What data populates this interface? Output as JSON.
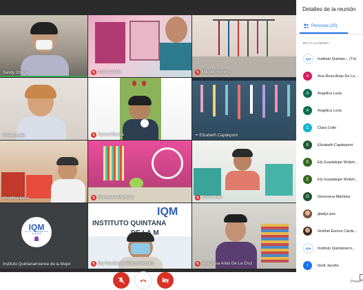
{
  "tiles": [
    {
      "name": "Sandy Ortega",
      "muted": false,
      "speaking": true
    },
    {
      "name": "Itzelt Jacobo",
      "muted": true
    },
    {
      "name": "Marbel Herrera",
      "muted": true
    },
    {
      "name": "Silvia Lopez",
      "muted": false
    },
    {
      "name": "Yaremi Rivera",
      "muted": true
    },
    {
      "name": "Elizabeth Capdepont",
      "muted": false,
      "dots": true
    },
    {
      "name": "Angelica Luna",
      "muted": false
    },
    {
      "name": "Genoveva Martinez",
      "muted": true
    },
    {
      "name": "Clara Colin",
      "muted": true
    },
    {
      "name": "Instituto Quintanarroense de la Mujer",
      "muted": false,
      "logo_text": "IQM",
      "logo_sub": "INSTITUTO QUINTANARROENSE DE LA MUJER"
    },
    {
      "name": "Ely Guadalupe Wuitzil Mendez",
      "muted": true,
      "sign_top": "IQM",
      "sign_line1": "INSTITUTO QUINTANA",
      "sign_line2": "DE LA M"
    },
    {
      "name": "Ana Rosa Arias De La Cruz",
      "muted": true
    }
  ],
  "panel": {
    "title": "Detalles de la reunión",
    "people_tab": "Personas (20)",
    "section": "EN LA LLAMADA",
    "present_label": "Presen"
  },
  "people": [
    {
      "name": "Instituto Quintan... (Tú)",
      "type": "logo",
      "color": "#1a73e8"
    },
    {
      "name": "Ana Rosa Arias De La ...",
      "initial": "A",
      "color": "#d81b60"
    },
    {
      "name": "Angelica Luna",
      "initial": "A",
      "color": "#0b6e4f"
    },
    {
      "name": "Angelica Luna",
      "initial": "A",
      "color": "#0b6e4f"
    },
    {
      "name": "Clara Colin",
      "initial": "C",
      "color": "#12b5cb"
    },
    {
      "name": "Elizabeth Capdepont",
      "initial": "E",
      "color": "#1e5631"
    },
    {
      "name": "Ely Guadalupe Wuitzil...",
      "initial": "E",
      "color": "#33691e"
    },
    {
      "name": "Ely Guadalupe Wuitzil...",
      "initial": "E",
      "color": "#33691e"
    },
    {
      "name": "Genoveva Martinez",
      "initial": "G",
      "color": "#1e5631"
    },
    {
      "name": "gladys puc",
      "type": "photo",
      "color": "#c58a6b"
    },
    {
      "name": "Grethel Eunice Cárde...",
      "type": "photo",
      "color": "#8d6e63"
    },
    {
      "name": "Instituto Quintanarro...",
      "type": "logo",
      "color": "#1a73e8"
    },
    {
      "name": "Itzelt Jacobo",
      "initial": "I",
      "color": "#1a73e8"
    }
  ],
  "colors": {
    "accent": "#1a73e8",
    "danger": "#d93025",
    "speaking": "#34a853"
  }
}
